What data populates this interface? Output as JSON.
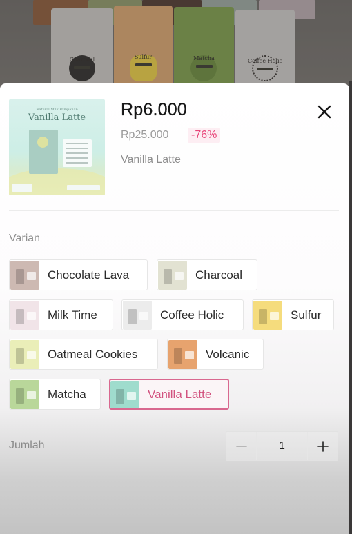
{
  "background_photo": {
    "packets": [
      {
        "name": "Charcoal",
        "color": "#c9c7c2"
      },
      {
        "name": "Sulfur",
        "color": "#d7a46e"
      },
      {
        "name": "Matcha",
        "color": "#7d9d4c"
      },
      {
        "name": "Coffee Holic",
        "color": "#cbc9c6"
      }
    ]
  },
  "product": {
    "image_subtitle": "Natural Milk Pompanan",
    "image_title": "Vanilla Latte",
    "price": "Rp6.000",
    "original_price": "Rp25.000",
    "discount": "-76%",
    "selected_variant": "Vanilla Latte"
  },
  "close_icon": "close-icon",
  "variants": {
    "label": "Varian",
    "items": [
      {
        "label": "Chocolate Lava",
        "thumb_color": "#cdb9b2",
        "selected": false
      },
      {
        "label": "Charcoal",
        "thumb_color": "#e2e2d2",
        "selected": false
      },
      {
        "label": "Milk Time",
        "thumb_color": "#f1e4e8",
        "selected": false
      },
      {
        "label": "Coffee Holic",
        "thumb_color": "#ececec",
        "selected": false
      },
      {
        "label": "Sulfur",
        "thumb_color": "#f5dc7d",
        "selected": false
      },
      {
        "label": "Oatmeal Cookies",
        "thumb_color": "#eaeeb8",
        "selected": false
      },
      {
        "label": "Volcanic",
        "thumb_color": "#e7a36e",
        "selected": false
      },
      {
        "label": "Matcha",
        "thumb_color": "#b9d79a",
        "selected": false
      },
      {
        "label": "Vanilla Latte",
        "thumb_color": "#9fdccd",
        "selected": true
      }
    ]
  },
  "quantity": {
    "label": "Jumlah",
    "value": "1",
    "decrement_icon": "minus-icon",
    "increment_icon": "plus-icon"
  },
  "colors": {
    "accent": "#d9688f",
    "discount_text": "#e8467a",
    "discount_bg": "#fdeef3"
  }
}
